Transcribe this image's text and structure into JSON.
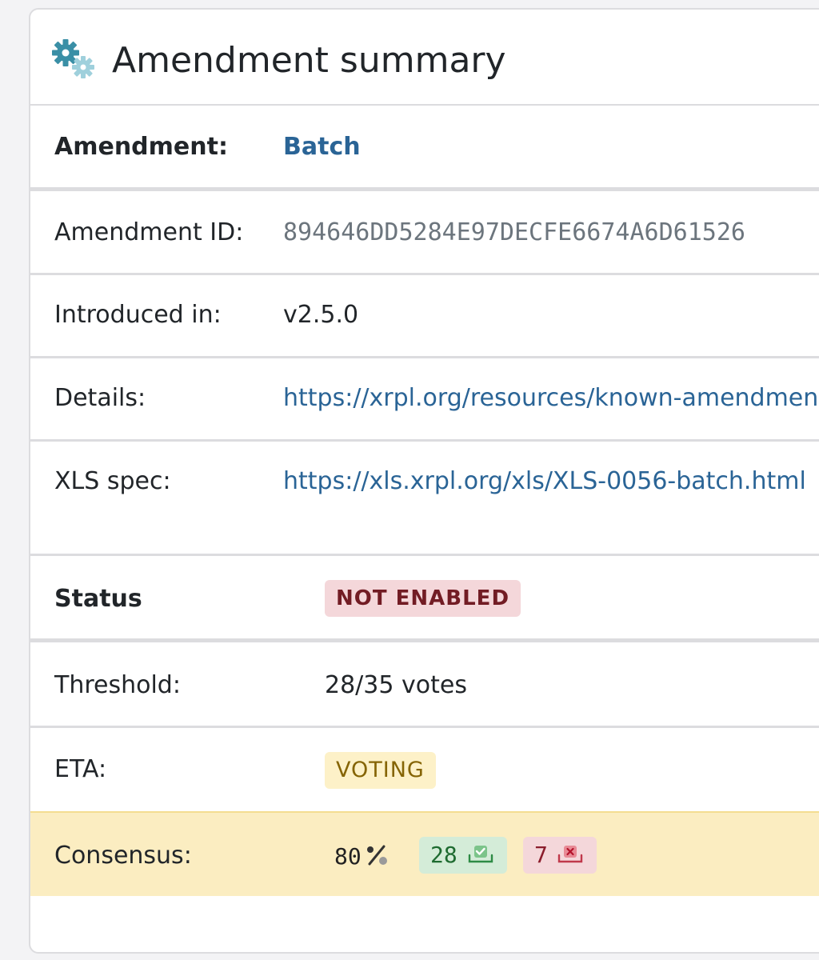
{
  "header": {
    "title": "Amendment summary",
    "icon": "gears-icon",
    "icon_colors": [
      "#3a8fa6",
      "#9fd0dc"
    ]
  },
  "rows": {
    "amendment": {
      "label": "Amendment:",
      "value": "Batch"
    },
    "amendment_id": {
      "label": "Amendment ID:",
      "value": "894646DD5284E97DECFE6674A6D61526"
    },
    "introduced": {
      "label": "Introduced in:",
      "value": "v2.5.0"
    },
    "details": {
      "label": "Details:",
      "value": "https://xrpl.org/resources/known-amendments"
    },
    "xls_spec": {
      "label": "XLS spec:",
      "value": "https://xls.xrpl.org/xls/XLS-0056-batch.html"
    }
  },
  "status": {
    "label": "Status",
    "badge": "NOT ENABLED",
    "badge_color": "#721c24"
  },
  "threshold": {
    "label": "Threshold:",
    "value": "28/35 votes"
  },
  "eta": {
    "label": "ETA:",
    "badge": "VOTING"
  },
  "consensus": {
    "label": "Consensus:",
    "percent": "80",
    "percent_sign": "%",
    "yes_votes": "28",
    "no_votes": "7",
    "yes_icon": "check-box-icon",
    "no_icon": "x-box-icon",
    "highlight_color": "#fbedc1"
  }
}
